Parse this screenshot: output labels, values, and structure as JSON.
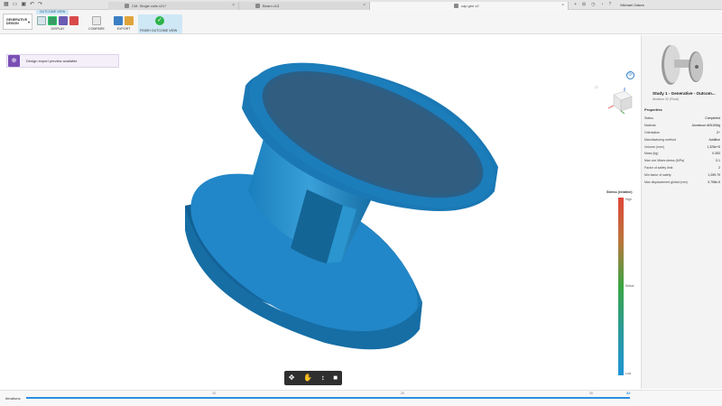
{
  "tabbar": {
    "tabs": [
      {
        "label": "CM- Single coils v21*"
      },
      {
        "label": "Bearn v13"
      },
      {
        "label": "cap gen v2"
      }
    ],
    "user": "Michael Oakes"
  },
  "toolbar": {
    "workspace": "GENERATIVE DESIGN",
    "outcome_tab": "OUTCOME VIEW",
    "display_label": "DISPLAY",
    "compare_label": "COMPARE",
    "export_label": "EXPORT",
    "finish_label": "FINISH OUTCOME VIEW"
  },
  "notification": {
    "text": "Design export preview available"
  },
  "legend": {
    "title": "Stress (relative)",
    "high": "High",
    "mid": "Select",
    "low": "Low",
    "colors": [
      "#e0473a",
      "#3aa545",
      "#1e94d6"
    ]
  },
  "iterations": {
    "label": "Iterations",
    "ticks": [
      "10",
      "20",
      "30",
      "32"
    ],
    "current": "32",
    "progress": 1.0
  },
  "panel": {
    "study_title": "Study 1 - Generative - Outcom...",
    "study_sub": "Iteration 32 (Final)",
    "properties_title": "Properties",
    "properties": [
      {
        "label": "Status",
        "value": "Completed"
      },
      {
        "label": "Material",
        "value": "Aluminum AlSi10Mg"
      },
      {
        "label": "Orientation",
        "value": "Z+"
      },
      {
        "label": "Manufacturing method",
        "value": "Additive"
      },
      {
        "label": "Volume (mm³)",
        "value": "1,325e+5"
      },
      {
        "label": "Mass (kg)",
        "value": "0.353"
      },
      {
        "label": "Max von Mises stress (MPa)",
        "value": "0.1"
      },
      {
        "label": "Factor of safety limit",
        "value": "2"
      },
      {
        "label": "Min factor of safety",
        "value": "1,259.79"
      },
      {
        "label": "Max displacement global (mm)",
        "value": "3.798e-5"
      }
    ]
  },
  "model_color": "#1d83c0"
}
